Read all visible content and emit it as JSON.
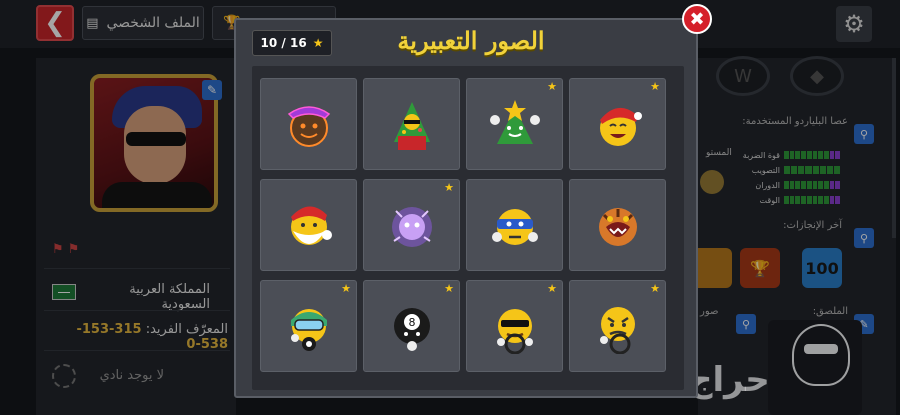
{
  "header": {
    "back_icon": "chevron-left-icon",
    "profile_tab_label": "الملف الشخصي",
    "trophy_tab_icon": "trophy-icon",
    "settings_icon": "gear-icon"
  },
  "profile": {
    "country": "المملكة العربية السعودية",
    "unique_id_label": "المعرّف الفريد:",
    "unique_id_value": "315-153-538-0",
    "no_club_text": "لا يوجد نادي"
  },
  "right_panel": {
    "cue_title": "عصا البلياردو المستخدمة:",
    "level_label": "المستو",
    "stats": [
      {
        "label": "قوة الضربة",
        "green": 8,
        "purple": 2
      },
      {
        "label": "التصويب",
        "green": 8,
        "purple": 0
      },
      {
        "label": "الدوران",
        "green": 8,
        "purple": 2
      },
      {
        "label": "الوقت",
        "green": 8,
        "purple": 2
      }
    ],
    "achievements_title": "آخر الإنجازات:",
    "achievement_badge_value": "100",
    "sticker_title": "الملصق:",
    "photos_label": "صور"
  },
  "modal": {
    "title": "الصور التعبيرية",
    "counter": "10 / 16",
    "emotes": [
      {
        "name": "cowboy-neon-emote-icon",
        "starred": false
      },
      {
        "name": "christmas-tree-gift-emote-icon",
        "starred": false
      },
      {
        "name": "christmas-tree-peace-emote-icon",
        "starred": true
      },
      {
        "name": "santa-laughing-emote-icon",
        "starred": true
      },
      {
        "name": "santa-beard-emote-icon",
        "starred": false
      },
      {
        "name": "purple-ghost-emote-icon",
        "starred": true
      },
      {
        "name": "masked-angry-emote-icon",
        "starred": false
      },
      {
        "name": "tiger-roar-emote-icon",
        "starred": false
      },
      {
        "name": "diver-emote-icon",
        "starred": true
      },
      {
        "name": "eight-ball-emote-icon",
        "starred": true
      },
      {
        "name": "sunglasses-driver-emote-icon",
        "starred": true
      },
      {
        "name": "driver-steering-emote-icon",
        "starred": true
      }
    ]
  },
  "watermark": "حراج",
  "colors": {
    "accent_gold": "#f1d23a",
    "close_red": "#d5202a",
    "id_gold": "#e6b840",
    "stat_green": "#2f9a3a",
    "stat_purple": "#8a3fd1"
  }
}
